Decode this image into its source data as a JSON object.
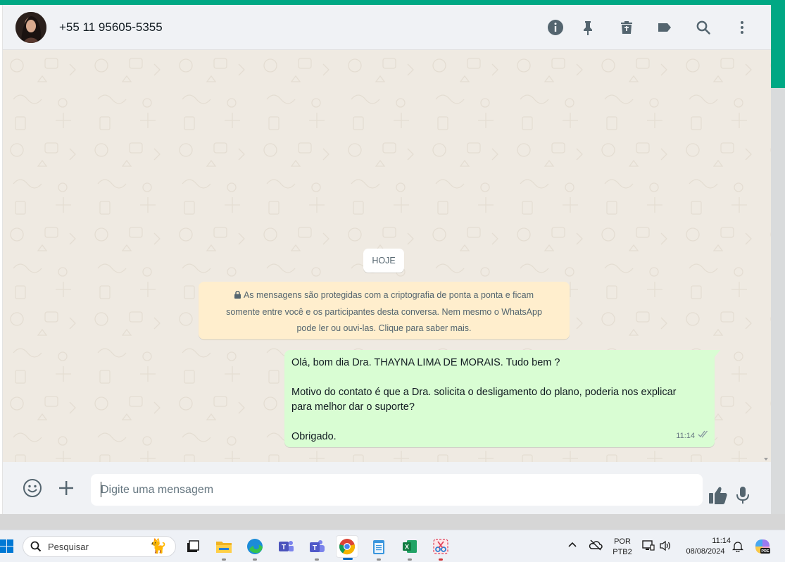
{
  "header": {
    "contact_name": "+55 11 95605-5355",
    "icons": [
      "info-icon",
      "pin-icon",
      "trash-icon",
      "label-icon",
      "search-icon",
      "menu-dots-icon"
    ]
  },
  "chat": {
    "date_chip": "HOJE",
    "encryption_notice": {
      "line1": "As mensagens são protegidas com a criptografia de ponta a ponta e ficam",
      "line2": "somente entre você e os participantes desta conversa. Nem mesmo o WhatsApp",
      "line3": "pode ler ou ouvi-las. Clique para saber mais."
    },
    "messages": [
      {
        "direction": "outgoing",
        "line1": "Olá, bom dia Dra. THAYNA LIMA DE MORAIS. Tudo bem ?",
        "line2": "Motivo do contato é que a Dra. solicita o desligamento do plano, poderia nos explicar",
        "line3": "para melhor dar o suporte?",
        "line4": "Obrigado.",
        "time": "11:14",
        "status": "delivered"
      }
    ]
  },
  "composer": {
    "placeholder": "Digite uma mensagem",
    "value": ""
  },
  "taskbar": {
    "search_placeholder": "Pesquisar",
    "apps": [
      "file-explorer",
      "edge",
      "teams-classic",
      "teams",
      "chrome",
      "notepad",
      "excel",
      "snipping-tool"
    ],
    "active_app": "chrome",
    "language": "POR",
    "keyboard": "PTB2",
    "time": "11:14",
    "date": "08/08/2024",
    "copilot_badge": "PRE"
  },
  "colors": {
    "accent": "#00a884",
    "outgoing_bubble": "#d9fdd3",
    "notice_bg": "#ffeecd",
    "chat_bg": "#efeae2"
  }
}
